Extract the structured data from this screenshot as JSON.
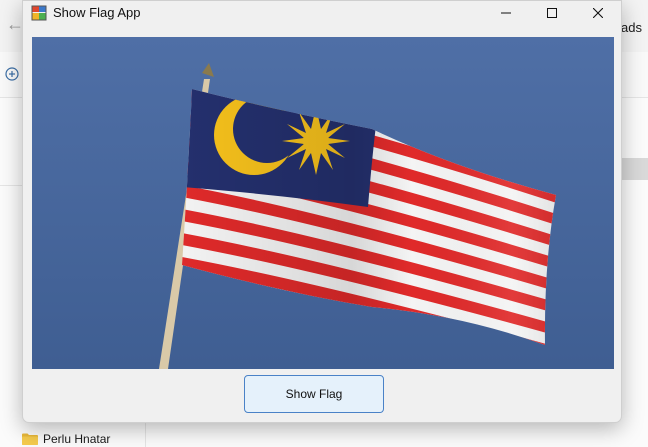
{
  "window": {
    "title": "Show Flag App",
    "controls": {
      "minimize": "minimize-icon",
      "maximize": "maximize-icon",
      "close": "close-icon"
    }
  },
  "picture": {
    "subject": "malaysia-flag",
    "colors": {
      "sky": "#48679a",
      "canton": "#24306e",
      "red_stripe": "#e02a2a",
      "white_stripe": "#f4f4f4",
      "yellow": "#f7c21c",
      "pole": "#d9c9a8"
    }
  },
  "button": {
    "label": "Show Flag"
  },
  "background_window": {
    "visible_text_right": "ads",
    "sidebar_item": "Perlu Hnatar",
    "icons": [
      "back-arrow-icon",
      "new-plus-icon",
      "folder-icon"
    ]
  }
}
